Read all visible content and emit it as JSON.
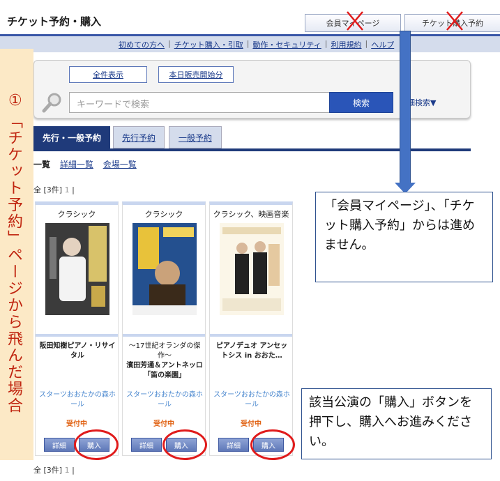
{
  "header": {
    "site_title": "チケット予約・購入",
    "tab_mypage": "会員マイページ",
    "tab_ticket": "チケット購入予約"
  },
  "links": [
    "初めての方へ",
    "チケット購入・引取",
    "動作・セキュリティ",
    "利用規約",
    "ヘルプ"
  ],
  "search": {
    "all_label": "全件表示",
    "today_label": "本日販売開始分",
    "placeholder": "キーワードで検索",
    "button": "検索",
    "advanced": "詳細検索▼"
  },
  "tabs": [
    "先行・一般予約",
    "先行予約",
    "一般予約"
  ],
  "subtabs": [
    "一覧",
    "詳細一覧",
    "会場一覧"
  ],
  "count_prefix": "全 [3件]",
  "count_page": "1",
  "count_suffix": "|",
  "cards": [
    {
      "genre": "クラシック",
      "title": "阪田知樹ピアノ・リサイタル",
      "subtitle": "",
      "venue": "スターツおおたかの森ホール",
      "status": "受付中",
      "detail": "詳細",
      "buy": "購入"
    },
    {
      "genre": "クラシック",
      "subtitle": "〜17世紀オランダの傑作〜",
      "title": "濱田芳通＆アントネッロ「笛の楽園」",
      "venue": "スターツおおたかの森ホール",
      "status": "受付中",
      "detail": "詳細",
      "buy": "購入"
    },
    {
      "genre": "クラシック、映画音楽",
      "title": "ピアノデュオ アンセットシス in おおた…",
      "subtitle": "",
      "venue": "スターツおおたかの森ホール",
      "status": "受付中",
      "detail": "詳細",
      "buy": "購入"
    }
  ],
  "annotations": {
    "left_number": "①",
    "left_text": "「チケット予約」ページから飛んだ場合",
    "note1": "「会員マイページ」、「チケット購入予約」からは進めません。",
    "note2": "該当公演の「購入」ボタンを押下し、購入へお進みください。"
  },
  "colors": {
    "accent": "#1f3a7a",
    "annotation_red": "#e01b1b",
    "arrow_blue": "#4472c4"
  }
}
